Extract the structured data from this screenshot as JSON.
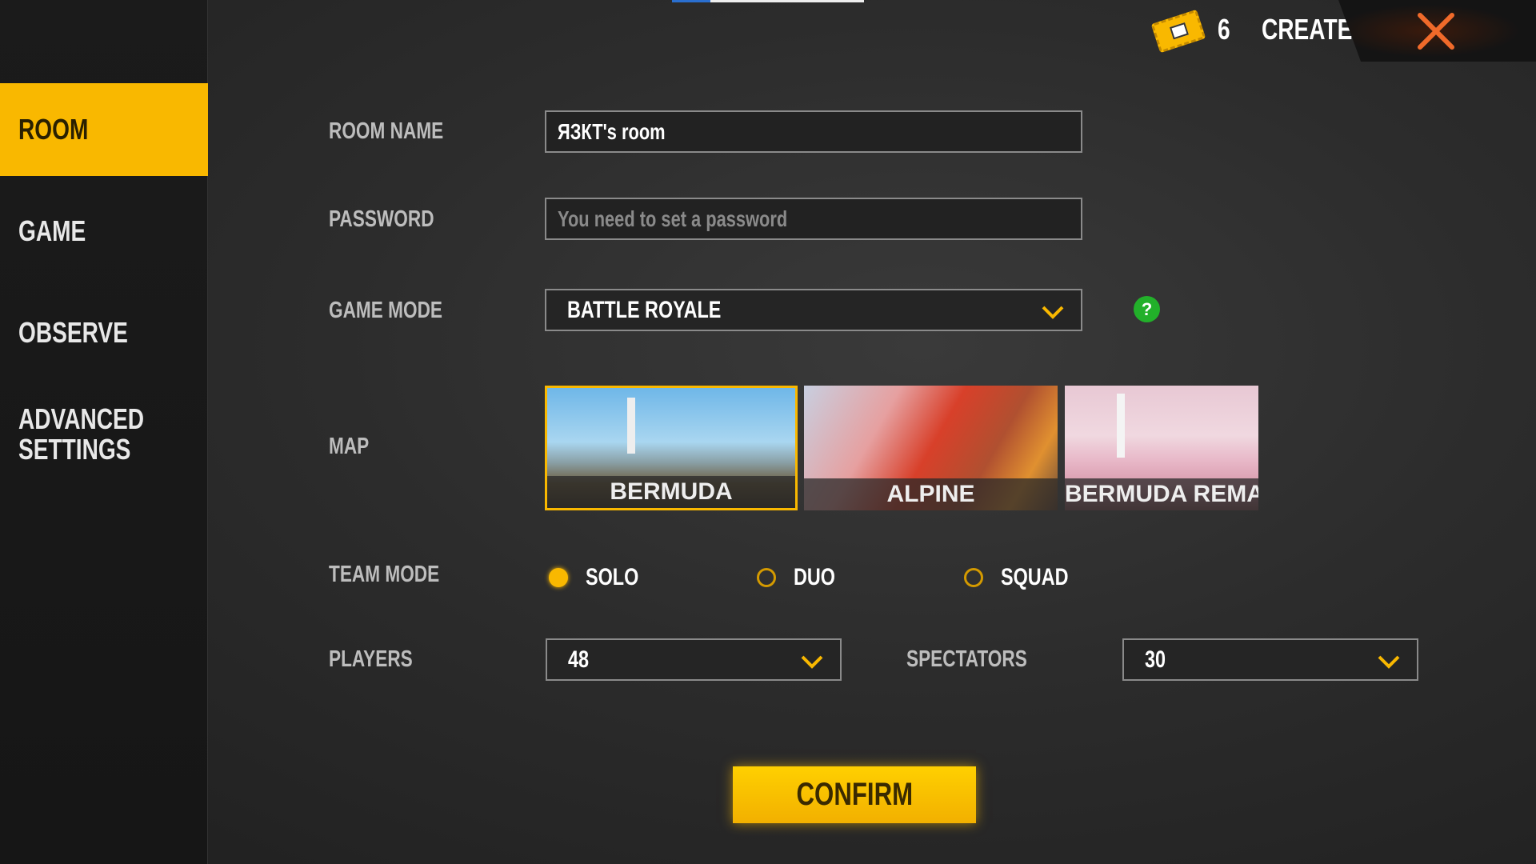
{
  "topbar": {
    "ticket_count": "6",
    "create_label": "CREATE",
    "close_icon": "close-icon",
    "ticket_icon": "room-card-ticket-icon"
  },
  "sidebar": {
    "items": [
      {
        "label": "ROOM",
        "active": true
      },
      {
        "label": "GAME"
      },
      {
        "label": "OBSERVE"
      },
      {
        "label": "ADVANCED SETTINGS"
      }
    ]
  },
  "form": {
    "room_name": {
      "label": "ROOM NAME",
      "value": "ЯЗКТ's room"
    },
    "password": {
      "label": "PASSWORD",
      "placeholder": "You need to set a password"
    },
    "game_mode": {
      "label": "GAME MODE",
      "value": "BATTLE ROYALE"
    },
    "map": {
      "label": "MAP",
      "options": [
        {
          "name": "BERMUDA",
          "selected": true
        },
        {
          "name": "ALPINE"
        },
        {
          "name": "BERMUDA REMASTE"
        }
      ]
    },
    "team_mode": {
      "label": "TEAM MODE",
      "options": [
        {
          "name": "SOLO",
          "selected": true
        },
        {
          "name": "DUO"
        },
        {
          "name": "SQUAD"
        }
      ]
    },
    "players": {
      "label": "PLAYERS",
      "value": "48"
    },
    "spectators": {
      "label": "SPECTATORS",
      "value": "30"
    }
  },
  "confirm_label": "CONFIRM",
  "colors": {
    "accent": "#f9b800",
    "close": "#f06a2a",
    "help": "#22b02a"
  }
}
